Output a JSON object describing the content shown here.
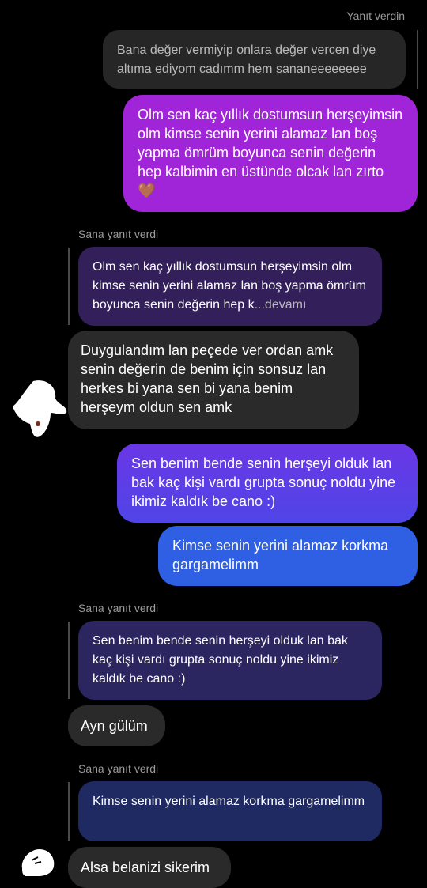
{
  "messages": {
    "replied_label_1": "Yanıt verdin",
    "quoted_own_1": "Bana değer vermiyip onlara değer vercen diye altıma ediyom cadımm hem sananeeeeeeee",
    "sent_1": "Olm sen kaç yıllık dostumsun herşeyimsin olm kimse senin yerini alamaz lan boş yapma ömrüm boyunca senin değerin hep kalbimin en üstünde olcak lan zırto 🤎",
    "reply_label_2": "Sana yanıt verdi",
    "quoted_2": "Olm sen kaç yıllık dostumsun herşeyimsin olm kimse senin yerini alamaz lan boş yapma ömrüm boyunca senin değerin hep k",
    "quoted_2_more": "...devamı",
    "received_1": "Duygulandım lan peçede ver ordan amk senin değerin de benim için sonsuz lan herkes bi yana sen bi yana benim herşeym oldun sen amk",
    "sent_2": "Sen benim bende senin herşeyi olduk lan bak kaç kişi vardı grupta sonuç noldu yine ikimiz kaldık be cano :)",
    "sent_3": "Kimse senin yerini alamaz korkma gargamelimm",
    "reply_label_3": "Sana yanıt verdi",
    "quoted_3": "Sen benim bende senin herşeyi olduk lan bak kaç kişi vardı grupta sonuç noldu yine ikimiz kaldık be cano :)",
    "received_2": "Ayn gülüm",
    "reply_label_4": "Sana yanıt verdi",
    "quoted_4": "Kimse senin yerini alamaz korkma gargamelimm",
    "received_3": "Alsa belanizi sikerim"
  },
  "colors": {
    "background": "#000000",
    "quoted_own_bubble": "#262626",
    "sent_gradient_top": "#a024d8",
    "sent_gradient_mid": "#6a37e6",
    "sent_gradient_bottom": "#2f60e4",
    "received_bubble": "#2a2a2a",
    "quoted_received_purple": "#33205a",
    "quoted_received_blue": "#1f2a63"
  },
  "icons": [
    "avatar-blob-1",
    "avatar-blob-2"
  ]
}
